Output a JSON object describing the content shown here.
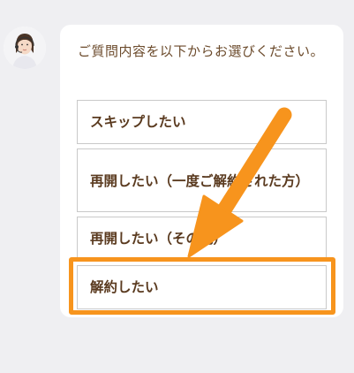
{
  "chat": {
    "prompt": "ご質問内容を以下からお選びください。",
    "options": [
      {
        "label": "スキップしたい"
      },
      {
        "label": "再開したい（一度ご解約された方）"
      },
      {
        "label": "再開したい（その他）"
      },
      {
        "label": "解約したい"
      }
    ]
  },
  "annotation": {
    "highlight_color": "#f7941d",
    "arrow_icon": "arrow-down-left-icon",
    "highlighted_option": "解約したい"
  },
  "colors": {
    "text_brown": "#5a3a1f",
    "background": "#efeff2"
  }
}
